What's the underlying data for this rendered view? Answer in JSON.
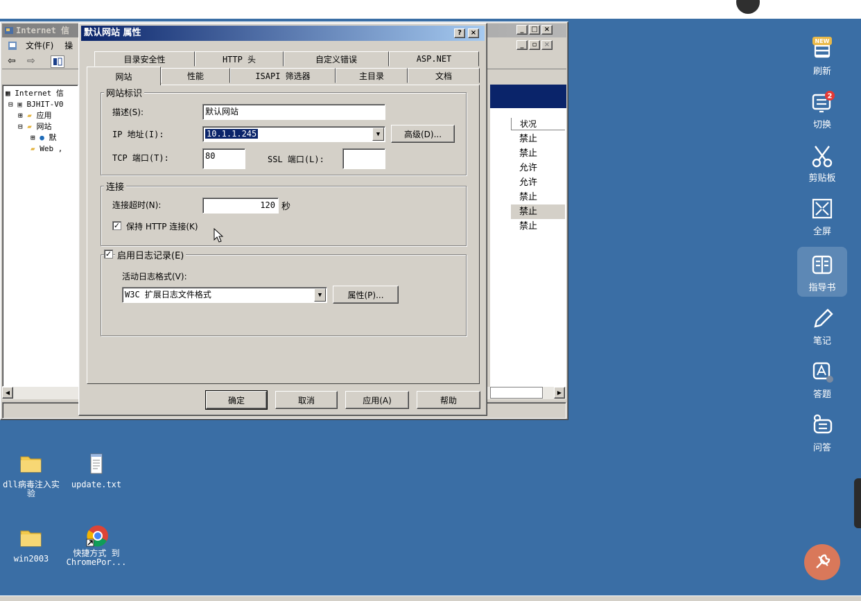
{
  "iis_manager": {
    "title": "Internet 信",
    "menu": {
      "file": "文件(F)",
      "next": "操"
    },
    "tree": [
      {
        "label": "Internet 信",
        "expander": ""
      },
      {
        "label": "BJHIT-V0",
        "expander": "⊟"
      },
      {
        "label": "应用",
        "expander": "⊞"
      },
      {
        "label": "网站",
        "expander": "⊟"
      },
      {
        "label": "默",
        "expander": "⊞"
      },
      {
        "label": "Web ,",
        "expander": ""
      }
    ],
    "status_column_header": "状况",
    "status_values": [
      "禁止",
      "禁止",
      "允许",
      "允许",
      "禁止",
      "禁止",
      "禁止"
    ],
    "selected_status_index": 5
  },
  "dialog": {
    "title": "默认网站 属性",
    "help_glyph": "?",
    "close_glyph": "×",
    "tabs_row1": [
      "目录安全性",
      "HTTP 头",
      "自定义错误",
      "ASP.NET"
    ],
    "tabs_row2": [
      "网站",
      "性能",
      "ISAPI 筛选器",
      "主目录",
      "文档"
    ],
    "active_tab": "网站",
    "site_identity": {
      "group_label": "网站标识",
      "description_label": "描述(S):",
      "description_value": "默认网站",
      "ip_label": "IP 地址(I):",
      "ip_value": "10.1.1.245",
      "advanced_button": "高级(D)...",
      "tcp_port_label": "TCP 端口(T):",
      "tcp_port_value": "80",
      "ssl_port_label": "SSL 端口(L):",
      "ssl_port_value": ""
    },
    "connections": {
      "group_label": "连接",
      "timeout_label": "连接超时(N):",
      "timeout_value": "120",
      "timeout_unit": "秒",
      "keep_alive_label": "保持 HTTP 连接(K)",
      "keep_alive_checked": true
    },
    "logging": {
      "group_label": "启用日志记录(E)",
      "enabled": true,
      "format_label": "活动日志格式(V):",
      "format_value": "W3C 扩展日志文件格式",
      "properties_button": "属性(P)..."
    },
    "buttons": {
      "ok": "确定",
      "cancel": "取消",
      "apply": "应用(A)",
      "help": "帮助"
    }
  },
  "desktop_icons": [
    {
      "label": "dll病毒注入实验",
      "icon": "folder-icon"
    },
    {
      "label": "update.txt",
      "icon": "notepad-file-icon"
    },
    {
      "label": "win2003",
      "icon": "folder-icon"
    },
    {
      "label": "快捷方式 到 ChromePor...",
      "icon": "chrome-shortcut-icon"
    }
  ],
  "tool_rail": [
    {
      "label": "刷新",
      "icon": "refresh-icon",
      "badge": "NEW"
    },
    {
      "label": "切换",
      "icon": "switch-screen-icon",
      "badge": "2"
    },
    {
      "label": "剪贴板",
      "icon": "scissors-icon",
      "badge": ""
    },
    {
      "label": "全屏",
      "icon": "fullscreen-icon",
      "badge": ""
    },
    {
      "label": "指导书",
      "icon": "guidebook-icon",
      "badge": ""
    },
    {
      "label": "笔记",
      "icon": "pencil-icon",
      "badge": ""
    },
    {
      "label": "答题",
      "icon": "answer-icon",
      "badge": ""
    },
    {
      "label": "问答",
      "icon": "qa-list-icon",
      "badge": ""
    }
  ],
  "colors": {
    "desktop": "#3a6ea5",
    "title_active_start": "#0a246a",
    "title_active_end": "#a6caf0",
    "badge_red": "#e53935",
    "tool_orange": "#d9785a"
  }
}
